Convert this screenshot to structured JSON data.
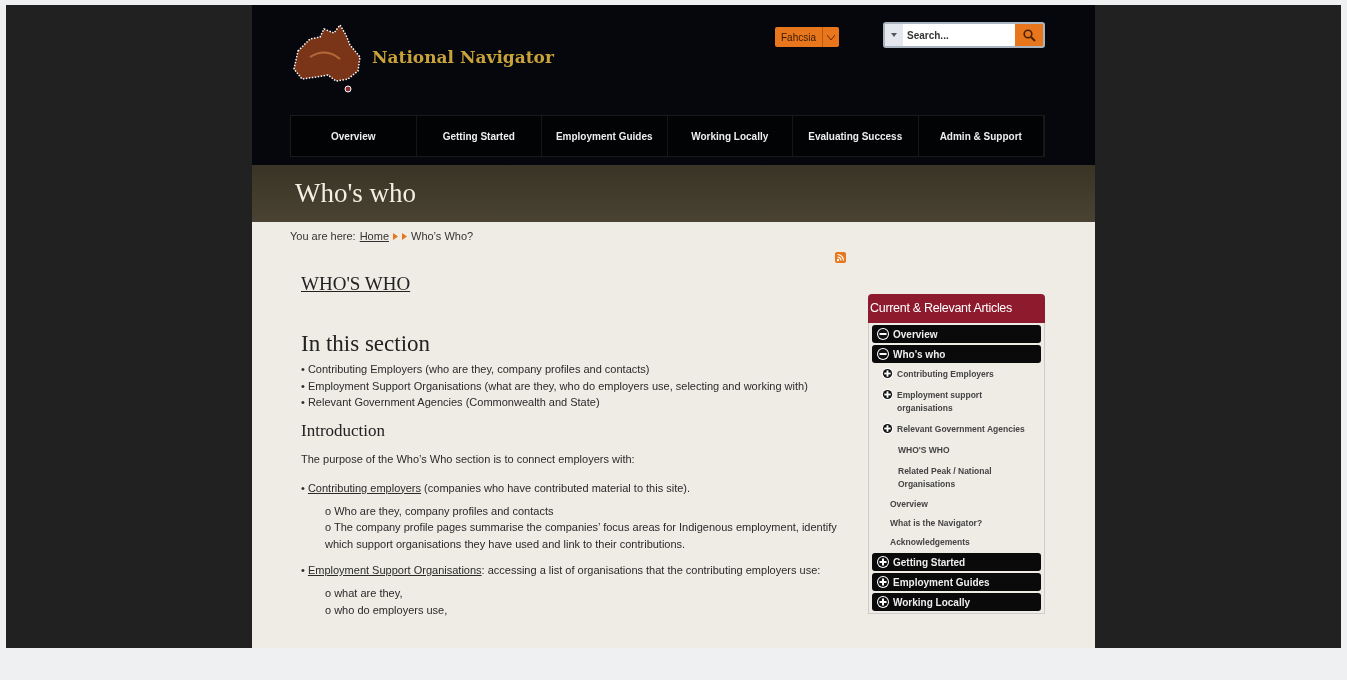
{
  "header": {
    "site_name": "National Navigator",
    "language": "Fahcsia",
    "search": {
      "placeholder": "Search..."
    }
  },
  "nav": [
    {
      "label": "Overview"
    },
    {
      "label": "Getting Started"
    },
    {
      "label": "Employment Guides"
    },
    {
      "label": "Working Locally"
    },
    {
      "label": "Evaluating Success"
    },
    {
      "label": "Admin & Support"
    }
  ],
  "banner": {
    "title": "Who's who"
  },
  "breadcrumb": {
    "prefix": "You are here:",
    "home": "Home",
    "current": "Who’s Who?"
  },
  "content": {
    "title": "WHO'S WHO",
    "section_heading": "In this section",
    "section_items": [
      "• Contributing Employers (who are they, company profiles and contacts)",
      "• Employment Support Organisations (what are they, who do employers use, selecting and working with)",
      "• Relevant Government Agencies (Commonwealth and State)"
    ],
    "intro_heading": "Introduction",
    "intro": "The purpose of the Who’s Who section is to connect employers with:",
    "groups": [
      {
        "bullet": "•",
        "link": "Contributing employers",
        "text": " (companies who have contributed material to this site).",
        "sub_items": [
          "o Who are they, company profiles and contacts",
          "o The company profile pages summarise the companies’ focus areas for Indigenous employment, identify which support organisations they have used and link to their contributions."
        ]
      },
      {
        "bullet": "•",
        "link": "Employment Support Organisations",
        "text": ": accessing a list of organisations that the contributing employers use:",
        "sub_items": [
          "o what are they,",
          "o who do employers use,"
        ]
      }
    ]
  },
  "sidebar": {
    "title": "Current & Relevant Articles",
    "items": [
      {
        "label": "Overview",
        "expanded": true
      },
      {
        "label": "Who's who",
        "expanded": true,
        "children": [
          {
            "kind": "toggle",
            "label": "Contributing Employers",
            "expanded": false
          },
          {
            "kind": "toggle",
            "label": "Employment support organisations",
            "expanded": false
          },
          {
            "kind": "toggle",
            "label": "Relevant Government Agencies",
            "expanded": false
          },
          {
            "kind": "page",
            "label": "WHO'S WHO"
          },
          {
            "kind": "page",
            "label": "Related Peak / National Organisations"
          },
          {
            "kind": "link",
            "label": "Overview"
          },
          {
            "kind": "link",
            "label": "What is the Navigator?"
          },
          {
            "kind": "link",
            "label": "Acknowledgements"
          }
        ]
      },
      {
        "label": "Getting Started",
        "expanded": false
      },
      {
        "label": "Employment Guides",
        "expanded": false
      },
      {
        "label": "Working Locally",
        "expanded": false
      }
    ]
  }
}
